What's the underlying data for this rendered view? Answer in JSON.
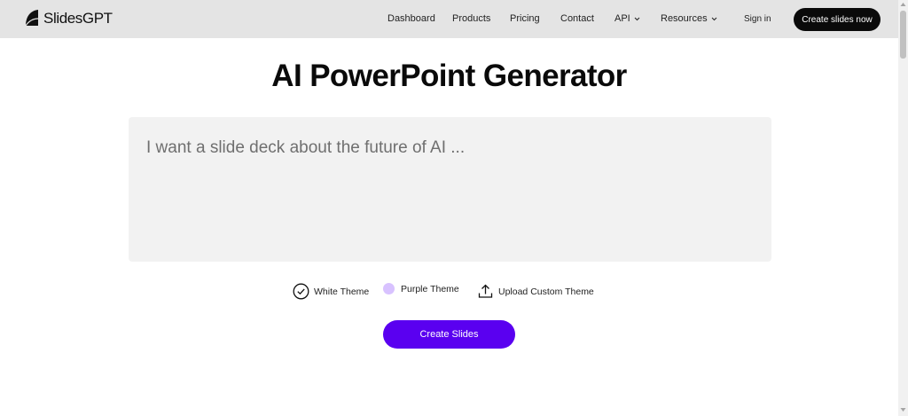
{
  "brand": {
    "name": "SlidesGPT"
  },
  "nav": {
    "items": [
      {
        "label": "Dashboard"
      },
      {
        "label": "Products"
      },
      {
        "label": "Pricing"
      },
      {
        "label": "Contact"
      },
      {
        "label": "API"
      },
      {
        "label": "Resources"
      }
    ],
    "signin_label": "Sign in",
    "cta_label": "Create slides now"
  },
  "main": {
    "title": "AI PowerPoint Generator",
    "prompt": {
      "placeholder": "I want a slide deck about the future of AI ...",
      "value": ""
    },
    "themes": [
      {
        "label": "White Theme",
        "icon": "check-circle-icon",
        "selected": true
      },
      {
        "label": "Purple Theme",
        "icon": "purple-dot-icon",
        "selected": false
      },
      {
        "label": "Upload Custom Theme",
        "icon": "upload-icon",
        "selected": false
      }
    ],
    "create_label": "Create Slides"
  },
  "colors": {
    "accent": "#5a00f0",
    "dark": "#0a0a0a",
    "nav_bg": "#e4e4e4",
    "purple_theme": "#d8c2ff"
  }
}
